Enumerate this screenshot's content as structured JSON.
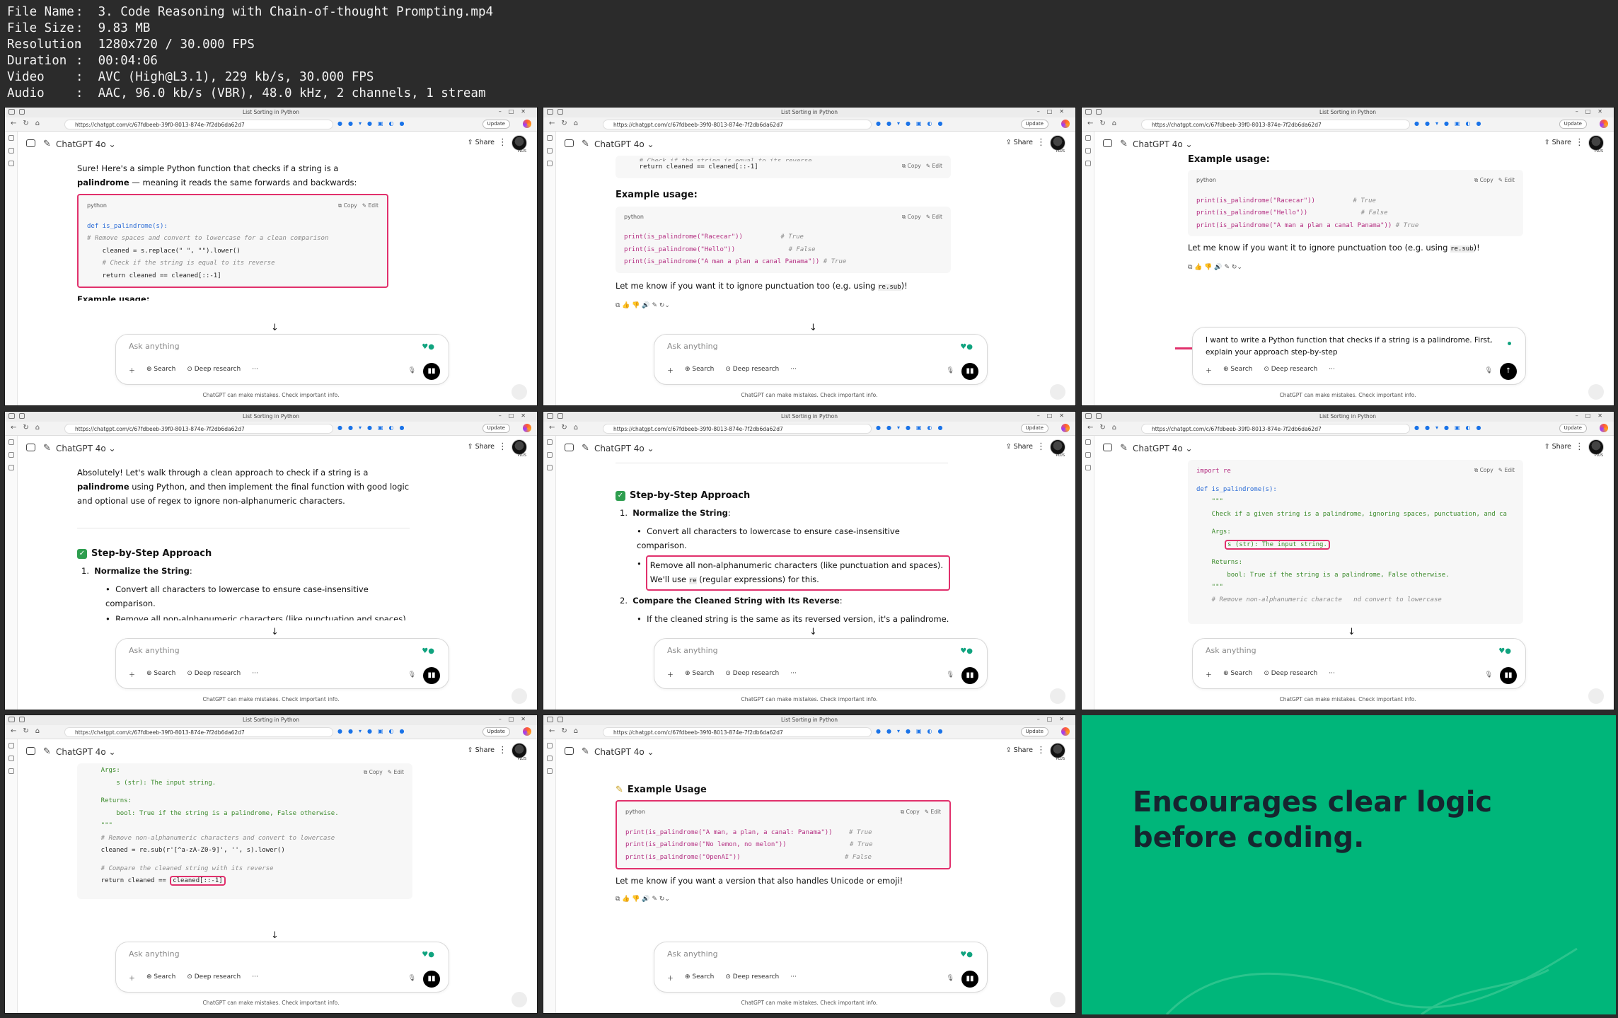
{
  "info": [
    {
      "k": "File Name",
      "v": "3. Code Reasoning with Chain-of-thought Prompting.mp4"
    },
    {
      "k": "File Size",
      "v": "9.83 MB"
    },
    {
      "k": "Resolution",
      "v": "1280x720 / 30.000 FPS"
    },
    {
      "k": "Duration",
      "v": "00:04:06"
    },
    {
      "k": "Video",
      "v": "AVC (High@L3.1), 229 kb/s, 30.000 FPS"
    },
    {
      "k": "Audio",
      "v": "AAC, 96.0 kb/s (VBR), 48.0 kHz, 2 channels, 1 stream"
    }
  ],
  "browser": {
    "tab_title": "List Sorting in Python",
    "url": "https://chatgpt.com/c/67fdbeeb-39f0-8013-874e-7f2db6da62d7",
    "update": "Update",
    "model": "ChatGPT 4o",
    "share": "Share",
    "plus": "PLUS"
  },
  "composer": {
    "placeholder": "Ask anything",
    "search": "Search",
    "deep_research": "Deep research",
    "dots": "···",
    "disclaimer": "ChatGPT can make mistakes. Check important info."
  },
  "code_ui": {
    "lang": "python",
    "copy": "Copy",
    "edit": "Edit"
  },
  "f1": {
    "intro1": "Sure! Here's a simple Python function that checks if a string is a ",
    "intro_bold": "palindrome",
    "intro2": " — meaning it reads the same forwards and backwards:",
    "l1": "def is_palindrome(s):",
    "l2": "    # Remove spaces and convert to lowercase for a clean comparison",
    "l3": "    cleaned = s.replace(\" \", \"\").lower()",
    "l4": "    # Check if the string is equal to its reverse",
    "l5": "    return cleaned == cleaned[::-1]",
    "cut": "Example usage:"
  },
  "f2": {
    "top_cmt": "    # Check if the string is equal to its reverse",
    "top_ret": "    return cleaned == cleaned[::-1]",
    "heading": "Example usage:",
    "p1": "print(is_palindrome(\"Racecar\"))",
    "c1": "# True",
    "p2": "print(is_palindrome(\"Hello\"))",
    "c2": "# False",
    "p3": "print(is_palindrome(\"A man a plan a canal Panama\"))",
    "c3": "# True",
    "note1": "Let me know if you want it to ignore punctuation too (e.g. using ",
    "note_code": "re.sub",
    "note2": ")!"
  },
  "f3": {
    "prompt": "I want to write a Python function that checks if a string is a palindrome. First, explain your approach step-by-step"
  },
  "f4": {
    "p1a": "Absolutely! Let's walk through a clean approach to check if a string is a ",
    "p1b": "palindrome",
    "p1c": " using Python, and then implement the final function with good logic and optional use of regex to ignore non-alphanumeric characters.",
    "heading": "Step-by-Step Approach",
    "s1": "Normalize the String",
    "s1_colon": ":",
    "b1": "Convert all characters to lowercase to ensure case-insensitive comparison.",
    "b2": "Remove all non-alphanumeric characters (like punctuation and spaces). We'll use"
  },
  "f5": {
    "b2b": "re",
    "b2c": " (regular expressions) for this.",
    "s2": "Compare the Cleaned String with Its Reverse",
    "b3": "If the cleaned string is the same as its reversed version, it's a palindrome."
  },
  "f6": {
    "l1": "import re",
    "l2": "def is_palindrome(s):",
    "l3": "    \"\"\"",
    "l4": "    Check if a given string is a palindrome, ignoring spaces, punctuation, and ca",
    "l5": "    Args:",
    "l6": "s (str): The input string.",
    "l7": "    Returns:",
    "l8": "        bool: True if the string is a palindrome, False otherwise.",
    "l9": "    \"\"\"",
    "l10": "    # Remove non-alphanumeric characte",
    "l10b": "nd convert to lowercase"
  },
  "f7": {
    "l1": "    Args:",
    "l2": "        s (str): The input string.",
    "l3": "    Returns:",
    "l4": "        bool: True if the string is a palindrome, False otherwise.",
    "l5": "    \"\"\"",
    "l6": "    # Remove non-alphanumeric characters and convert to lowercase",
    "l7": "    cleaned = re.sub(r'[^a-zA-Z0-9]', '', s).lower()",
    "l8": "    # Compare the cleaned string with its reverse",
    "l9": "    return cleaned == ",
    "l9b": "cleaned[::-1]"
  },
  "f8": {
    "heading": "Example Usage",
    "p1": "print(is_palindrome(\"A man, a plan, a canal: Panama\"))",
    "c1": "# True",
    "p2": "print(is_palindrome(\"No lemon, no melon\"))",
    "c2": "# True",
    "p3": "print(is_palindrome(\"OpenAI\"))",
    "c3": "# False",
    "note": "Let me know if you want a version that also handles Unicode or emoji!"
  },
  "slide": {
    "text": "Encourages clear logic before coding."
  },
  "colors": {
    "highlight": "#e1306c",
    "slide_bg": "#00b67a",
    "slide_text": "#16252f"
  }
}
